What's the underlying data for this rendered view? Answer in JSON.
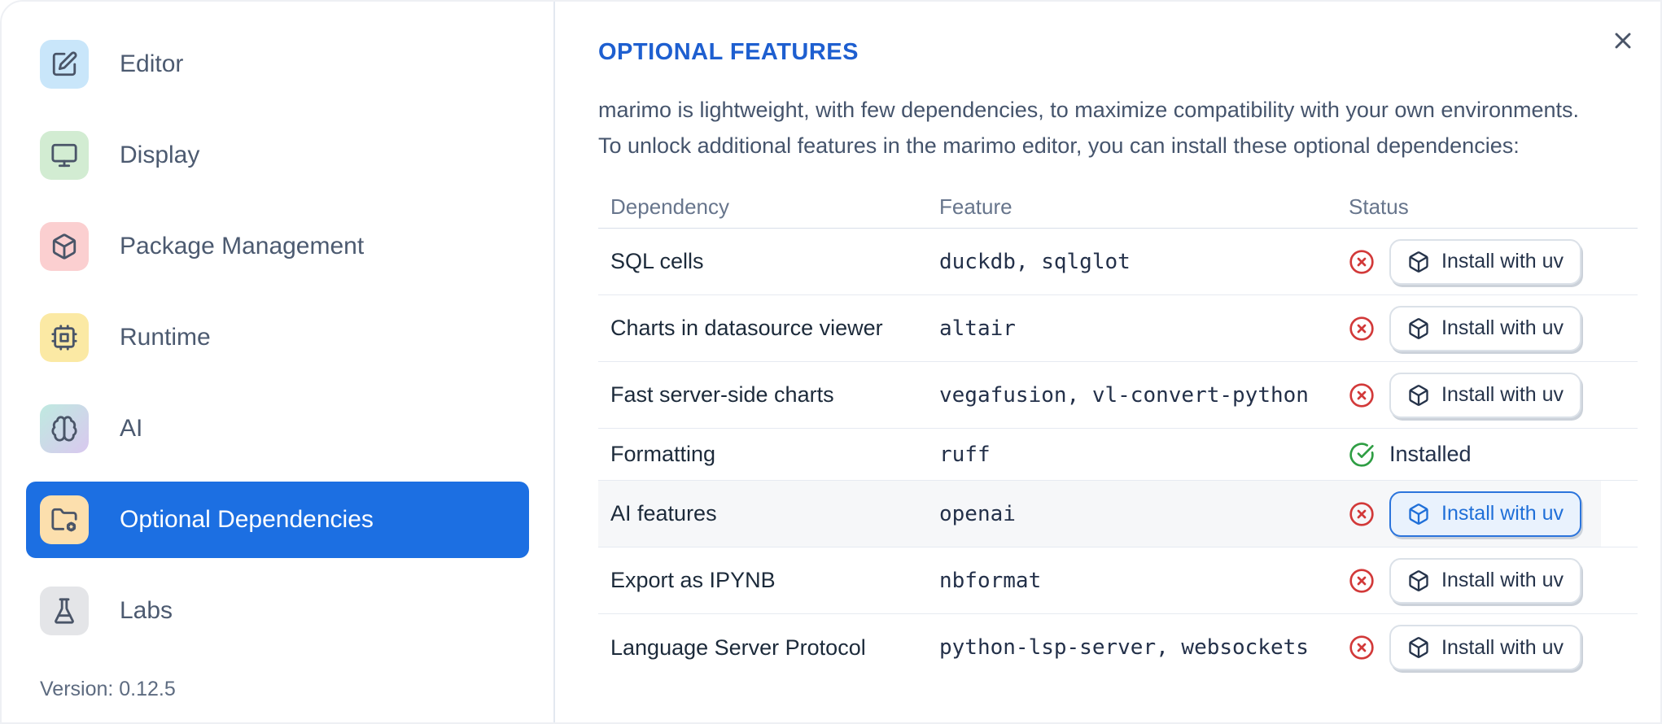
{
  "sidebar": {
    "items": [
      {
        "label": "Editor",
        "icon": "square-pen-icon",
        "tile_color": "#c9e6fa",
        "selected": false
      },
      {
        "label": "Display",
        "icon": "monitor-icon",
        "tile_color": "#d2ecd2",
        "selected": false
      },
      {
        "label": "Package Management",
        "icon": "package-icon",
        "tile_color": "#fbcfd0",
        "selected": false
      },
      {
        "label": "Runtime",
        "icon": "cpu-icon",
        "tile_color": "#fbe9a4",
        "selected": false
      },
      {
        "label": "AI",
        "icon": "brain-icon",
        "tile_color": "linear-gradient(#bfeae0,#d9c8ef)",
        "selected": false
      },
      {
        "label": "Optional Dependencies",
        "icon": "folder-cog-icon",
        "tile_color": "#fcdfad",
        "selected": true
      },
      {
        "label": "Labs",
        "icon": "flask-icon",
        "tile_color": "#e4e5e8",
        "selected": false
      }
    ],
    "version": "Version: 0.12.5"
  },
  "panel": {
    "title": "OPTIONAL FEATURES",
    "description_line1": "marimo is lightweight, with few dependencies, to maximize compatibility with your own environments.",
    "description_line2": "To unlock additional features in the marimo editor, you can install these optional dependencies:",
    "close_icon": "x-icon"
  },
  "table": {
    "columns": [
      "Dependency",
      "Feature",
      "Status"
    ],
    "rows": [
      {
        "dependency": "SQL cells",
        "feature": "duckdb, sqlglot",
        "status": "missing",
        "action_label": "Install with uv",
        "focused": false
      },
      {
        "dependency": "Charts in datasource viewer",
        "feature": "altair",
        "status": "missing",
        "action_label": "Install with uv",
        "focused": false
      },
      {
        "dependency": "Fast server-side charts",
        "feature": "vegafusion, vl-convert-python",
        "status": "missing",
        "action_label": "Install with uv",
        "focused": false
      },
      {
        "dependency": "Formatting",
        "feature": "ruff",
        "status": "installed",
        "status_label": "Installed"
      },
      {
        "dependency": "AI features",
        "feature": "openai",
        "status": "missing",
        "action_label": "Install with uv",
        "focused": true
      },
      {
        "dependency": "Export as IPYNB",
        "feature": "nbformat",
        "status": "missing",
        "action_label": "Install with uv",
        "focused": false
      },
      {
        "dependency": "Language Server Protocol",
        "feature": "python-lsp-server, websockets",
        "status": "missing",
        "action_label": "Install with uv",
        "focused": false
      }
    ]
  },
  "colors": {
    "selected_item_bg": "#1c6fe2",
    "title_blue": "#1e5fd0",
    "focus_button_blue": "#1f6fd8",
    "missing_red": "#d23939",
    "installed_green": "#2f9e44"
  }
}
